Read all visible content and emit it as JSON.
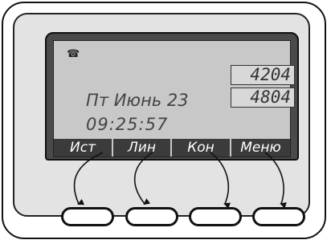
{
  "screen": {
    "phone_icon": "☎",
    "lines": [
      "4204",
      "4804"
    ],
    "date": "Пт Июнь 23",
    "time": "09:25:57",
    "softkeys": [
      "Ист",
      "Лин",
      "Кон",
      "Меню"
    ]
  },
  "colors": {
    "screen_bg": "#c8c8c8",
    "softkey_bg": "#3b3b3b",
    "frame": "#4a4a4a"
  }
}
